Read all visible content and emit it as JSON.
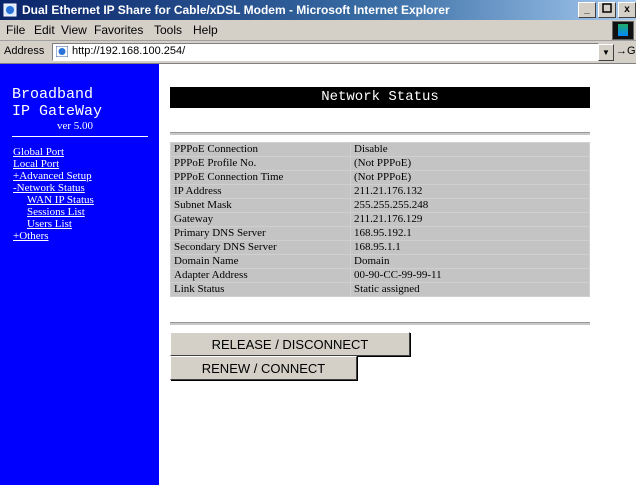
{
  "window": {
    "title": "Dual Ethernet IP Share for Cable/xDSL Modem - Microsoft Internet Explorer",
    "controls": [
      "_",
      "\u0000",
      "x"
    ]
  },
  "menu": [
    {
      "label": "File"
    },
    {
      "label": "Edit"
    },
    {
      "label": "View"
    },
    {
      "label": "Favorites"
    },
    {
      "label": "Tools"
    },
    {
      "label": "Help"
    }
  ],
  "address": {
    "label": "Address",
    "url": "http://192.168.100.254/",
    "go_label": "→Go"
  },
  "sidebar": {
    "brand_line1": "Broadband",
    "brand_line2": "IP GateWay",
    "version": "ver 5.00",
    "items": [
      {
        "label": "Global Port"
      },
      {
        "label": "Local Port"
      },
      {
        "label": "+Advanced Setup"
      },
      {
        "label": "-Network Status"
      },
      {
        "label": "WAN IP Status"
      },
      {
        "label": "Sessions List"
      },
      {
        "label": "Users List"
      },
      {
        "label": "+Others"
      }
    ]
  },
  "main": {
    "heading": "Network Status",
    "rows": [
      {
        "label": "PPPoE Connection",
        "value": "Disable"
      },
      {
        "label": "PPPoE Profile No.",
        "value": "(Not PPPoE)"
      },
      {
        "label": "PPPoE Connection Time",
        "value": "(Not PPPoE)"
      },
      {
        "label": "IP Address",
        "value": "211.21.176.132"
      },
      {
        "label": "Subnet Mask",
        "value": "255.255.255.248"
      },
      {
        "label": "Gateway",
        "value": "211.21.176.129"
      },
      {
        "label": "Primary DNS Server",
        "value": "168.95.192.1"
      },
      {
        "label": "Secondary DNS Server",
        "value": "168.95.1.1"
      },
      {
        "label": "Domain Name",
        "value": "Domain"
      },
      {
        "label": "Adapter Address",
        "value": "00-90-CC-99-99-11"
      },
      {
        "label": "Link Status",
        "value": "Static assigned"
      }
    ],
    "release_button": "RELEASE / DISCONNECT",
    "renew_button": "RENEW / CONNECT"
  }
}
